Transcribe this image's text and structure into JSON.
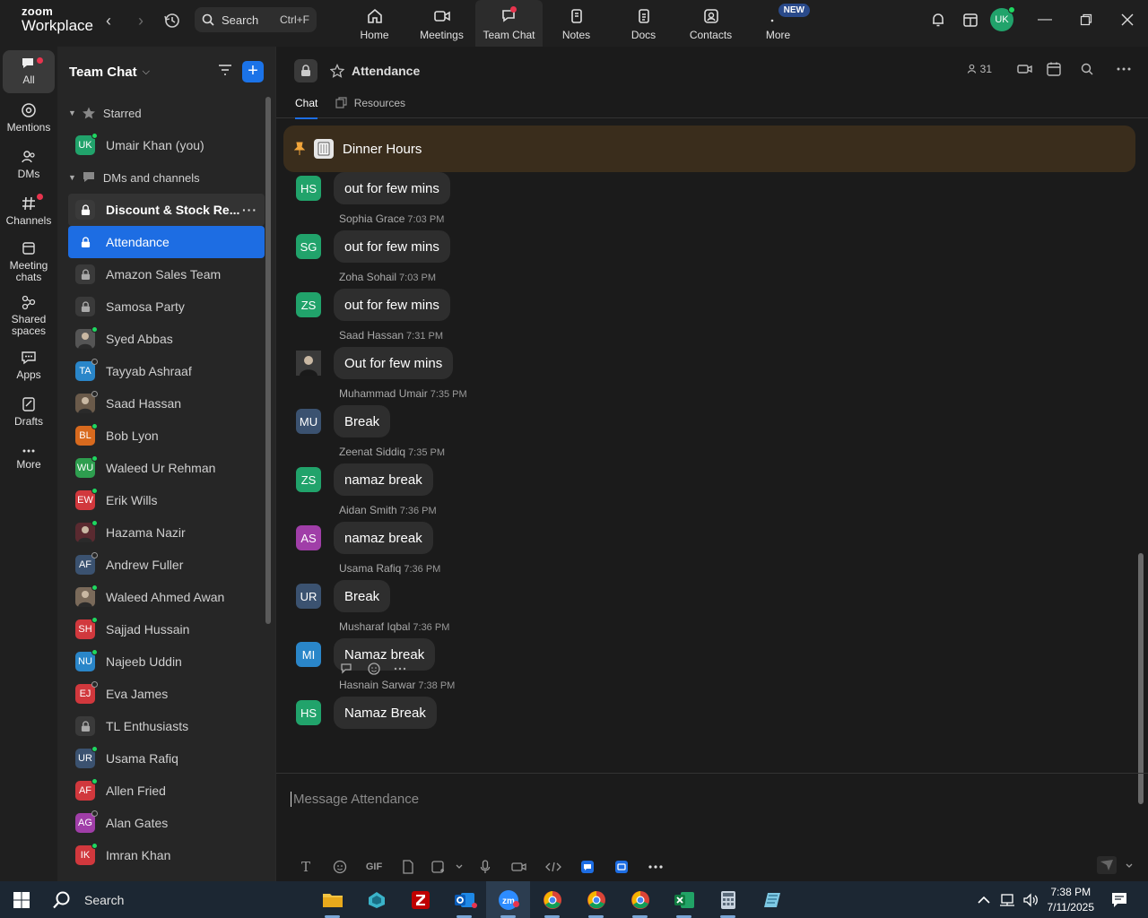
{
  "app": {
    "logo_line1": "zoom",
    "logo_line2": "Workplace",
    "search_label": "Search",
    "search_shortcut": "Ctrl+F",
    "nav": [
      {
        "label": "Home",
        "icon": "home-icon"
      },
      {
        "label": "Meetings",
        "icon": "video-icon"
      },
      {
        "label": "Team Chat",
        "icon": "chat-icon"
      },
      {
        "label": "Notes",
        "icon": "notes-icon"
      },
      {
        "label": "Docs",
        "icon": "docs-icon"
      },
      {
        "label": "Contacts",
        "icon": "contacts-icon"
      },
      {
        "label": "More",
        "icon": "more-icon"
      }
    ],
    "new_badge": "NEW",
    "user_initials": "UK"
  },
  "rail": [
    {
      "label": "All"
    },
    {
      "label": "Mentions"
    },
    {
      "label": "DMs"
    },
    {
      "label": "Channels"
    },
    {
      "label": "Meeting chats"
    },
    {
      "label": "Shared spaces"
    },
    {
      "label": "Apps"
    },
    {
      "label": "Drafts"
    },
    {
      "label": "More"
    }
  ],
  "sidebar": {
    "title": "Team Chat",
    "starred_label": "Starred",
    "dms_label": "DMs and channels",
    "starred": [
      {
        "name": "Umair Khan (you)",
        "initials": "UK",
        "color": "#21a36b",
        "status": "online"
      }
    ],
    "items": [
      {
        "name": "Discount & Stock Re...",
        "type": "channel",
        "bold": true
      },
      {
        "name": "Attendance",
        "type": "channel",
        "selected": true
      },
      {
        "name": "Amazon Sales Team",
        "type": "channel"
      },
      {
        "name": "Samosa Party",
        "type": "channel"
      },
      {
        "name": "Syed Abbas",
        "initials": "",
        "color": "#555555",
        "status": "online"
      },
      {
        "name": "Tayyab Ashraaf",
        "initials": "TA",
        "color": "#2a86c9",
        "status": "offline"
      },
      {
        "name": "Saad Hassan",
        "initials": "",
        "color": "#6a5a4a",
        "status": "offline"
      },
      {
        "name": "Bob Lyon",
        "initials": "BL",
        "color": "#d86a1e",
        "status": "online"
      },
      {
        "name": "Waleed Ur Rehman",
        "initials": "WU",
        "color": "#2e9e4f",
        "status": "online"
      },
      {
        "name": "Erik Wills",
        "initials": "EW",
        "color": "#d1383d",
        "status": "online"
      },
      {
        "name": "Hazama Nazir",
        "initials": "",
        "color": "#5a2a30",
        "status": "online"
      },
      {
        "name": "Andrew Fuller",
        "initials": "AF",
        "color": "#3b5270",
        "status": "offline"
      },
      {
        "name": "Waleed Ahmed Awan",
        "initials": "",
        "color": "#7a6a5a",
        "status": "online"
      },
      {
        "name": "Sajjad Hussain",
        "initials": "SH",
        "color": "#d1383d",
        "status": "online"
      },
      {
        "name": "Najeeb Uddin",
        "initials": "NU",
        "color": "#2a86c9",
        "status": "online"
      },
      {
        "name": "Eva James",
        "initials": "EJ",
        "color": "#d1383d",
        "status": "offline"
      },
      {
        "name": "TL Enthusiasts",
        "type": "channel"
      },
      {
        "name": "Usama Rafiq",
        "initials": "UR",
        "color": "#3b5270",
        "status": "online"
      },
      {
        "name": "Allen Fried",
        "initials": "AF",
        "color": "#d1383d",
        "status": "online"
      },
      {
        "name": "Alan Gates",
        "initials": "AG",
        "color": "#a03ea8",
        "status": "offline"
      },
      {
        "name": "Imran Khan",
        "initials": "IK",
        "color": "#d1383d",
        "status": "online"
      }
    ]
  },
  "channel": {
    "title": "Attendance",
    "member_count": "31",
    "tabs": [
      "Chat",
      "Resources"
    ],
    "pinned": "Dinner Hours",
    "composer_placeholder": "Message Attendance",
    "gif_label": "GIF"
  },
  "messages": [
    {
      "initials": "HS",
      "color": "#21a36b",
      "sender": "",
      "time": "",
      "text": "out for few mins"
    },
    {
      "initials": "SG",
      "color": "#21a36b",
      "sender": "Sophia Grace",
      "time": "7:03 PM",
      "text": "out for few mins"
    },
    {
      "initials": "ZS",
      "color": "#21a36b",
      "sender": "Zoha Sohail",
      "time": "7:03 PM",
      "text": "out for few mins"
    },
    {
      "initials": "",
      "color": "#4a4a4a",
      "sender": "Saad Hassan",
      "time": "7:31 PM",
      "text": "Out for few mins"
    },
    {
      "initials": "MU",
      "color": "#3b5270",
      "sender": "Muhammad Umair",
      "time": "7:35 PM",
      "text": "Break"
    },
    {
      "initials": "ZS",
      "color": "#21a36b",
      "sender": "Zeenat Siddiq",
      "time": "7:35 PM",
      "text": "namaz break"
    },
    {
      "initials": "AS",
      "color": "#a03ea8",
      "sender": "Aidan Smith",
      "time": "7:36 PM",
      "text": "namaz break"
    },
    {
      "initials": "UR",
      "color": "#3b5270",
      "sender": "Usama Rafiq",
      "time": "7:36 PM",
      "text": "Break"
    },
    {
      "initials": "MI",
      "color": "#2a86c9",
      "sender": "Musharaf Iqbal",
      "time": "7:36 PM",
      "text": "Namaz break"
    },
    {
      "initials": "HS",
      "color": "#21a36b",
      "sender": "Hasnain Sarwar",
      "time": "7:38 PM",
      "text": "Namaz Break"
    }
  ],
  "taskbar": {
    "search_label": "Search",
    "time": "7:38 PM",
    "date": "7/11/2025"
  }
}
